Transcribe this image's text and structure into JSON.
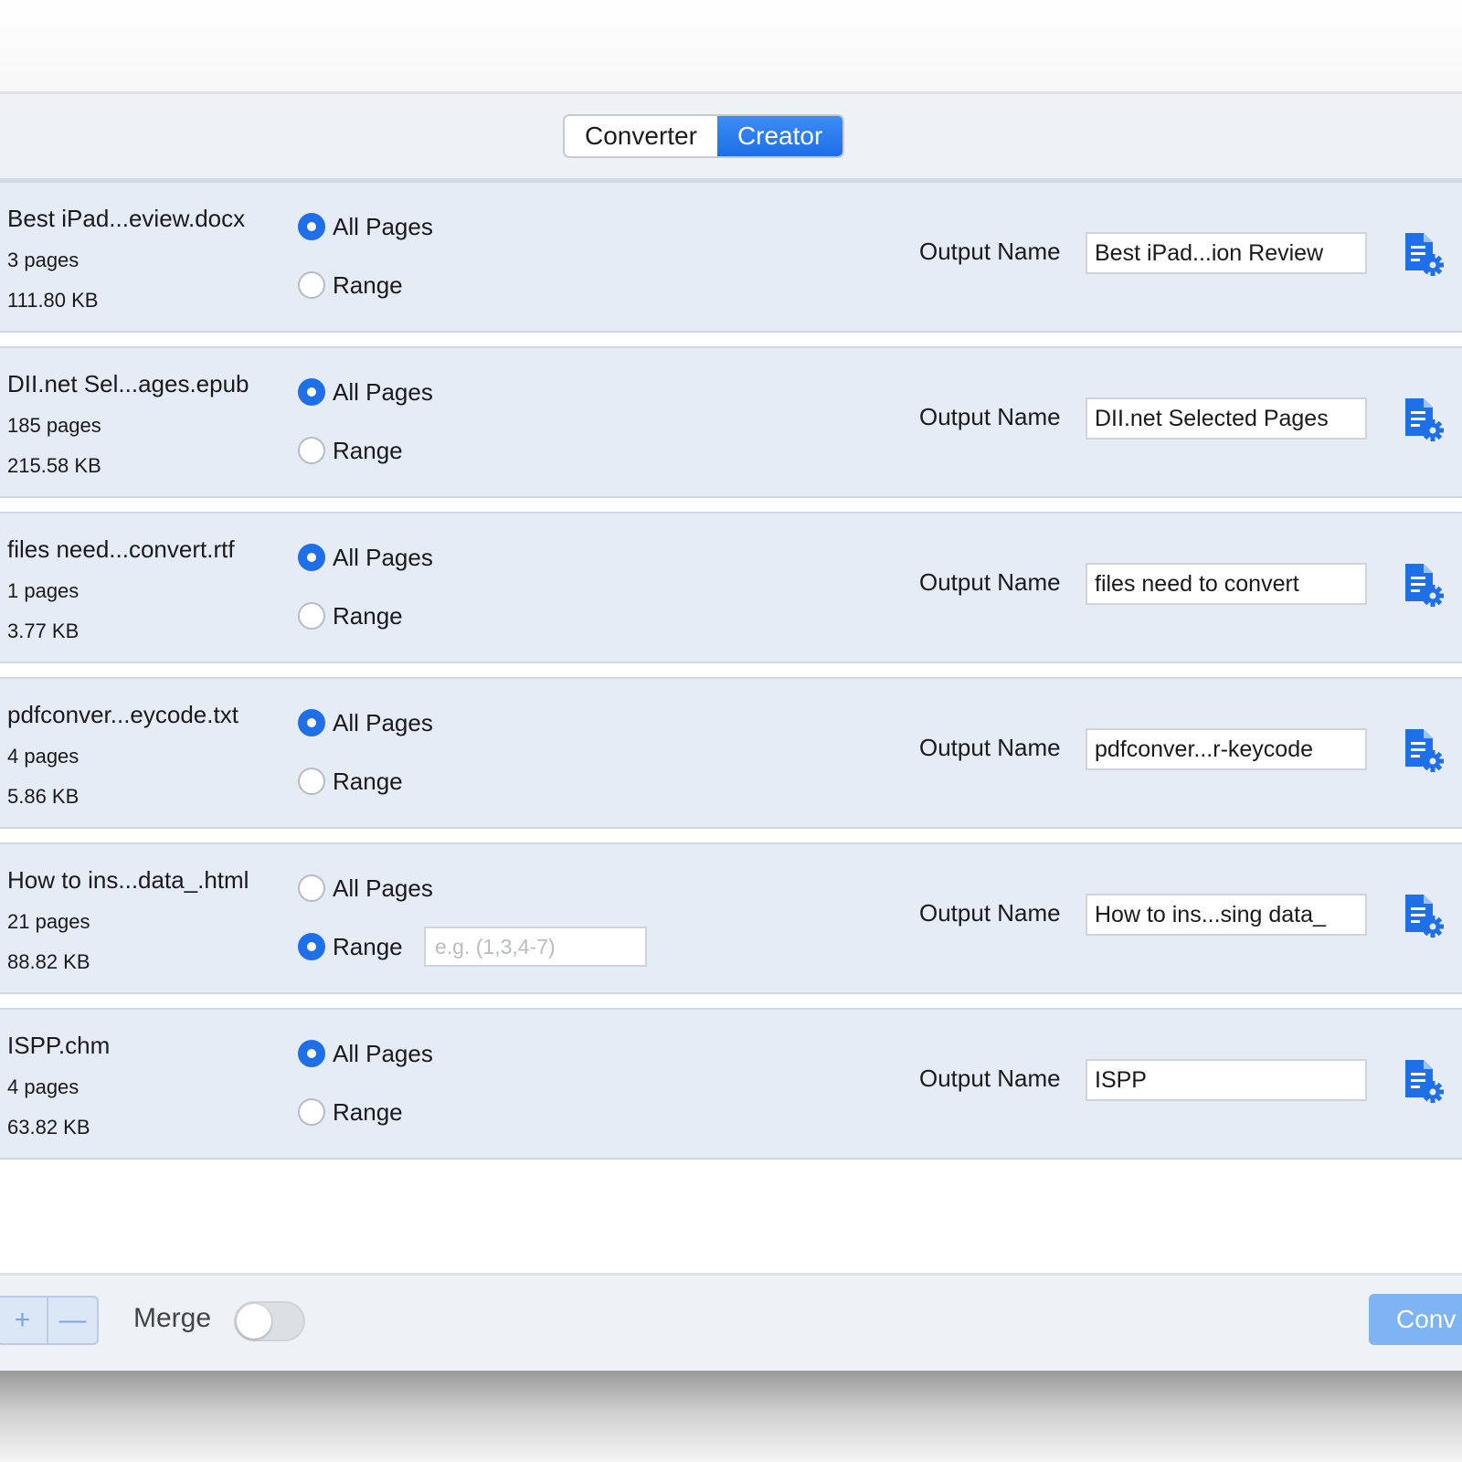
{
  "tabs": [
    {
      "label": "Converter",
      "active": false
    },
    {
      "label": "Creator",
      "active": true
    }
  ],
  "labels": {
    "all_pages": "All Pages",
    "range": "Range",
    "output_name": "Output Name",
    "range_placeholder": "e.g. (1,3,4-7)"
  },
  "files": [
    {
      "name": "Best iPad...eview.docx",
      "pages": "3 pages",
      "size": "111.80 KB",
      "selection": "all",
      "output_name": "Best iPad...ion Review"
    },
    {
      "name": "DII.net Sel...ages.epub",
      "pages": "185 pages",
      "size": "215.58 KB",
      "selection": "all",
      "output_name": "DII.net Selected Pages"
    },
    {
      "name": "files need...convert.rtf",
      "pages": "1 pages",
      "size": "3.77 KB",
      "selection": "all",
      "output_name": "files need to convert"
    },
    {
      "name": "pdfconver...eycode.txt",
      "pages": "4 pages",
      "size": "5.86 KB",
      "selection": "all",
      "output_name": "pdfconver...r-keycode"
    },
    {
      "name": "How to ins...data_.html",
      "pages": "21 pages",
      "size": "88.82 KB",
      "selection": "range",
      "output_name": "How to ins...sing data_"
    },
    {
      "name": "ISPP.chm",
      "pages": "4 pages",
      "size": "63.82 KB",
      "selection": "all",
      "output_name": "ISPP"
    }
  ],
  "footer": {
    "add_symbol": "+",
    "remove_symbol": "—",
    "merge_label": "Merge",
    "merge_on": false,
    "convert_label": "Conv"
  },
  "icons": {
    "row_settings": "document-gear-icon",
    "add": "plus-icon",
    "remove": "minus-icon"
  },
  "colors": {
    "accent": "#1f6fe8",
    "row_background": "#e6ecf6",
    "convert_button": "#7eb4f4"
  }
}
